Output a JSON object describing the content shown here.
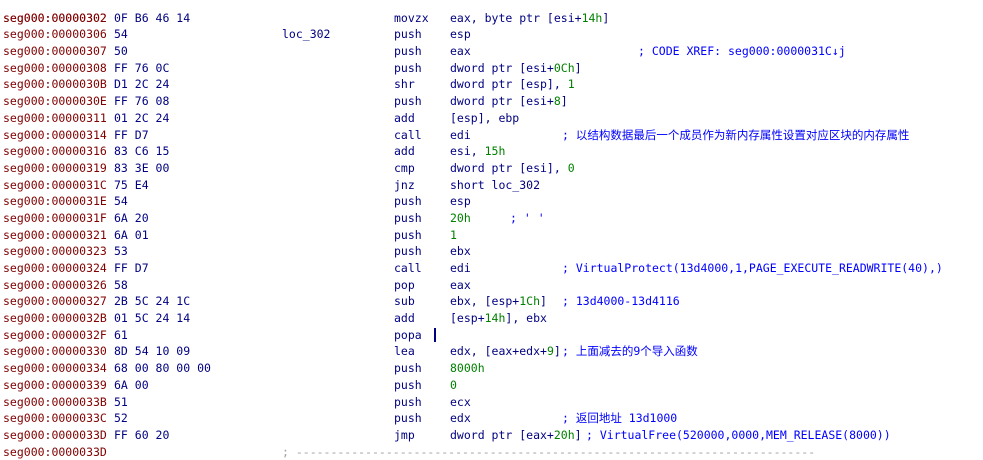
{
  "listing": {
    "rows": [
      {
        "addr": "seg000:00000302",
        "bytes": "0F B6 46 14",
        "label": "",
        "mnem": "movzx",
        "ops": [
          {
            "t": "eax, byte ptr [esi+"
          },
          {
            "t": "14h",
            "n": true
          },
          {
            "t": "]"
          }
        ],
        "comment": "",
        "comment_col": 0,
        "top_text": "loc_302",
        "top_comment": "; CODE XREF: seg000:0000031C↓j"
      },
      {
        "addr": "seg000:00000306",
        "bytes": "54",
        "label": "",
        "mnem": "push",
        "ops": [
          {
            "t": "esp"
          }
        ],
        "comment": ""
      },
      {
        "addr": "seg000:00000307",
        "bytes": "50",
        "label": "",
        "mnem": "push",
        "ops": [
          {
            "t": "eax"
          }
        ],
        "comment": ""
      },
      {
        "addr": "seg000:00000308",
        "bytes": "FF 76 0C",
        "label": "",
        "mnem": "push",
        "ops": [
          {
            "t": "dword ptr [esi+"
          },
          {
            "t": "0Ch",
            "n": true
          },
          {
            "t": "]"
          }
        ],
        "comment": ""
      },
      {
        "addr": "seg000:0000030B",
        "bytes": "D1 2C 24",
        "label": "",
        "mnem": "shr",
        "ops": [
          {
            "t": "dword ptr [esp], "
          },
          {
            "t": "1",
            "n": true
          }
        ],
        "comment": ""
      },
      {
        "addr": "seg000:0000030E",
        "bytes": "FF 76 08",
        "label": "",
        "mnem": "push",
        "ops": [
          {
            "t": "dword ptr [esi+"
          },
          {
            "t": "8",
            "n": true
          },
          {
            "t": "]"
          }
        ],
        "comment": ""
      },
      {
        "addr": "seg000:00000311",
        "bytes": "01 2C 24",
        "label": "",
        "mnem": "add",
        "ops": [
          {
            "t": "[esp], ebp"
          }
        ],
        "comment": ""
      },
      {
        "addr": "seg000:00000314",
        "bytes": "FF D7",
        "label": "",
        "mnem": "call",
        "ops": [
          {
            "t": "edi"
          }
        ],
        "comment": "; 以结构数据最后一个成员作为新内存属性设置对应区块的内存属性"
      },
      {
        "addr": "seg000:00000316",
        "bytes": "83 C6 15",
        "label": "",
        "mnem": "add",
        "ops": [
          {
            "t": "esi, "
          },
          {
            "t": "15h",
            "n": true
          }
        ],
        "comment": ""
      },
      {
        "addr": "seg000:00000319",
        "bytes": "83 3E 00",
        "label": "",
        "mnem": "cmp",
        "ops": [
          {
            "t": "dword ptr [esi], "
          },
          {
            "t": "0",
            "n": true
          }
        ],
        "comment": ""
      },
      {
        "addr": "seg000:0000031C",
        "bytes": "75 E4",
        "label": "",
        "mnem": "jnz",
        "ops": [
          {
            "t": "short loc_302"
          }
        ],
        "comment": ""
      },
      {
        "addr": "seg000:0000031E",
        "bytes": "54",
        "label": "",
        "mnem": "push",
        "ops": [
          {
            "t": "esp"
          }
        ],
        "comment": ""
      },
      {
        "addr": "seg000:0000031F",
        "bytes": "6A 20",
        "label": "",
        "mnem": "push",
        "ops": [
          {
            "t": "20h",
            "n": true
          }
        ],
        "comment": "; ' '",
        "comment_col": 0
      },
      {
        "addr": "seg000:00000321",
        "bytes": "6A 01",
        "label": "",
        "mnem": "push",
        "ops": [
          {
            "t": "1",
            "n": true
          }
        ],
        "comment": ""
      },
      {
        "addr": "seg000:00000323",
        "bytes": "53",
        "label": "",
        "mnem": "push",
        "ops": [
          {
            "t": "ebx"
          }
        ],
        "comment": ""
      },
      {
        "addr": "seg000:00000324",
        "bytes": "FF D7",
        "label": "",
        "mnem": "call",
        "ops": [
          {
            "t": "edi"
          }
        ],
        "comment": "; VirtualProtect(13d4000,1,PAGE_EXECUTE_READWRITE(40),)"
      },
      {
        "addr": "seg000:00000326",
        "bytes": "58",
        "label": "",
        "mnem": "pop",
        "ops": [
          {
            "t": "eax"
          }
        ],
        "comment": ""
      },
      {
        "addr": "seg000:00000327",
        "bytes": "2B 5C 24 1C",
        "label": "",
        "mnem": "sub",
        "ops": [
          {
            "t": "ebx, [esp+"
          },
          {
            "t": "1Ch",
            "n": true
          },
          {
            "t": "]"
          }
        ],
        "comment": "; 13d4000-13d4116"
      },
      {
        "addr": "seg000:0000032B",
        "bytes": "01 5C 24 14",
        "label": "",
        "mnem": "add",
        "ops": [
          {
            "t": "[esp+"
          },
          {
            "t": "14h",
            "n": true
          },
          {
            "t": "], ebx"
          }
        ],
        "comment": ""
      },
      {
        "addr": "seg000:0000032F",
        "bytes": "61",
        "label": "",
        "mnem": "popa",
        "ops": [],
        "comment": "",
        "caret": true
      },
      {
        "addr": "seg000:00000330",
        "bytes": "8D 54 10 09",
        "label": "",
        "mnem": "lea",
        "ops": [
          {
            "t": "edx, [eax+edx+"
          },
          {
            "t": "9",
            "n": true
          },
          {
            "t": "]"
          }
        ],
        "comment": "; 上面减去的9个导入函数"
      },
      {
        "addr": "seg000:00000334",
        "bytes": "68 00 80 00 00",
        "label": "",
        "mnem": "push",
        "ops": [
          {
            "t": "8000h",
            "n": true
          }
        ],
        "comment": ""
      },
      {
        "addr": "seg000:00000339",
        "bytes": "6A 00",
        "label": "",
        "mnem": "push",
        "ops": [
          {
            "t": "0",
            "n": true
          }
        ],
        "comment": ""
      },
      {
        "addr": "seg000:0000033B",
        "bytes": "51",
        "label": "",
        "mnem": "push",
        "ops": [
          {
            "t": "ecx"
          }
        ],
        "comment": ""
      },
      {
        "addr": "seg000:0000033C",
        "bytes": "52",
        "label": "",
        "mnem": "push",
        "ops": [
          {
            "t": "edx"
          }
        ],
        "comment": "; 返回地址 13d1000"
      },
      {
        "addr": "seg000:0000033D",
        "bytes": "FF 60 20",
        "label": "",
        "mnem": "jmp",
        "ops": [
          {
            "t": "dword ptr [eax+"
          },
          {
            "t": "20h",
            "n": true
          },
          {
            "t": "]"
          }
        ],
        "comment": "; VirtualFree(520000,0000,MEM_RELEASE(8000))"
      },
      {
        "addr": "seg000:0000033D",
        "bytes": "",
        "label": "",
        "mnem": "",
        "ops": [],
        "comment": "",
        "separator": "; ---------------------------------------------------------------------------"
      }
    ]
  }
}
